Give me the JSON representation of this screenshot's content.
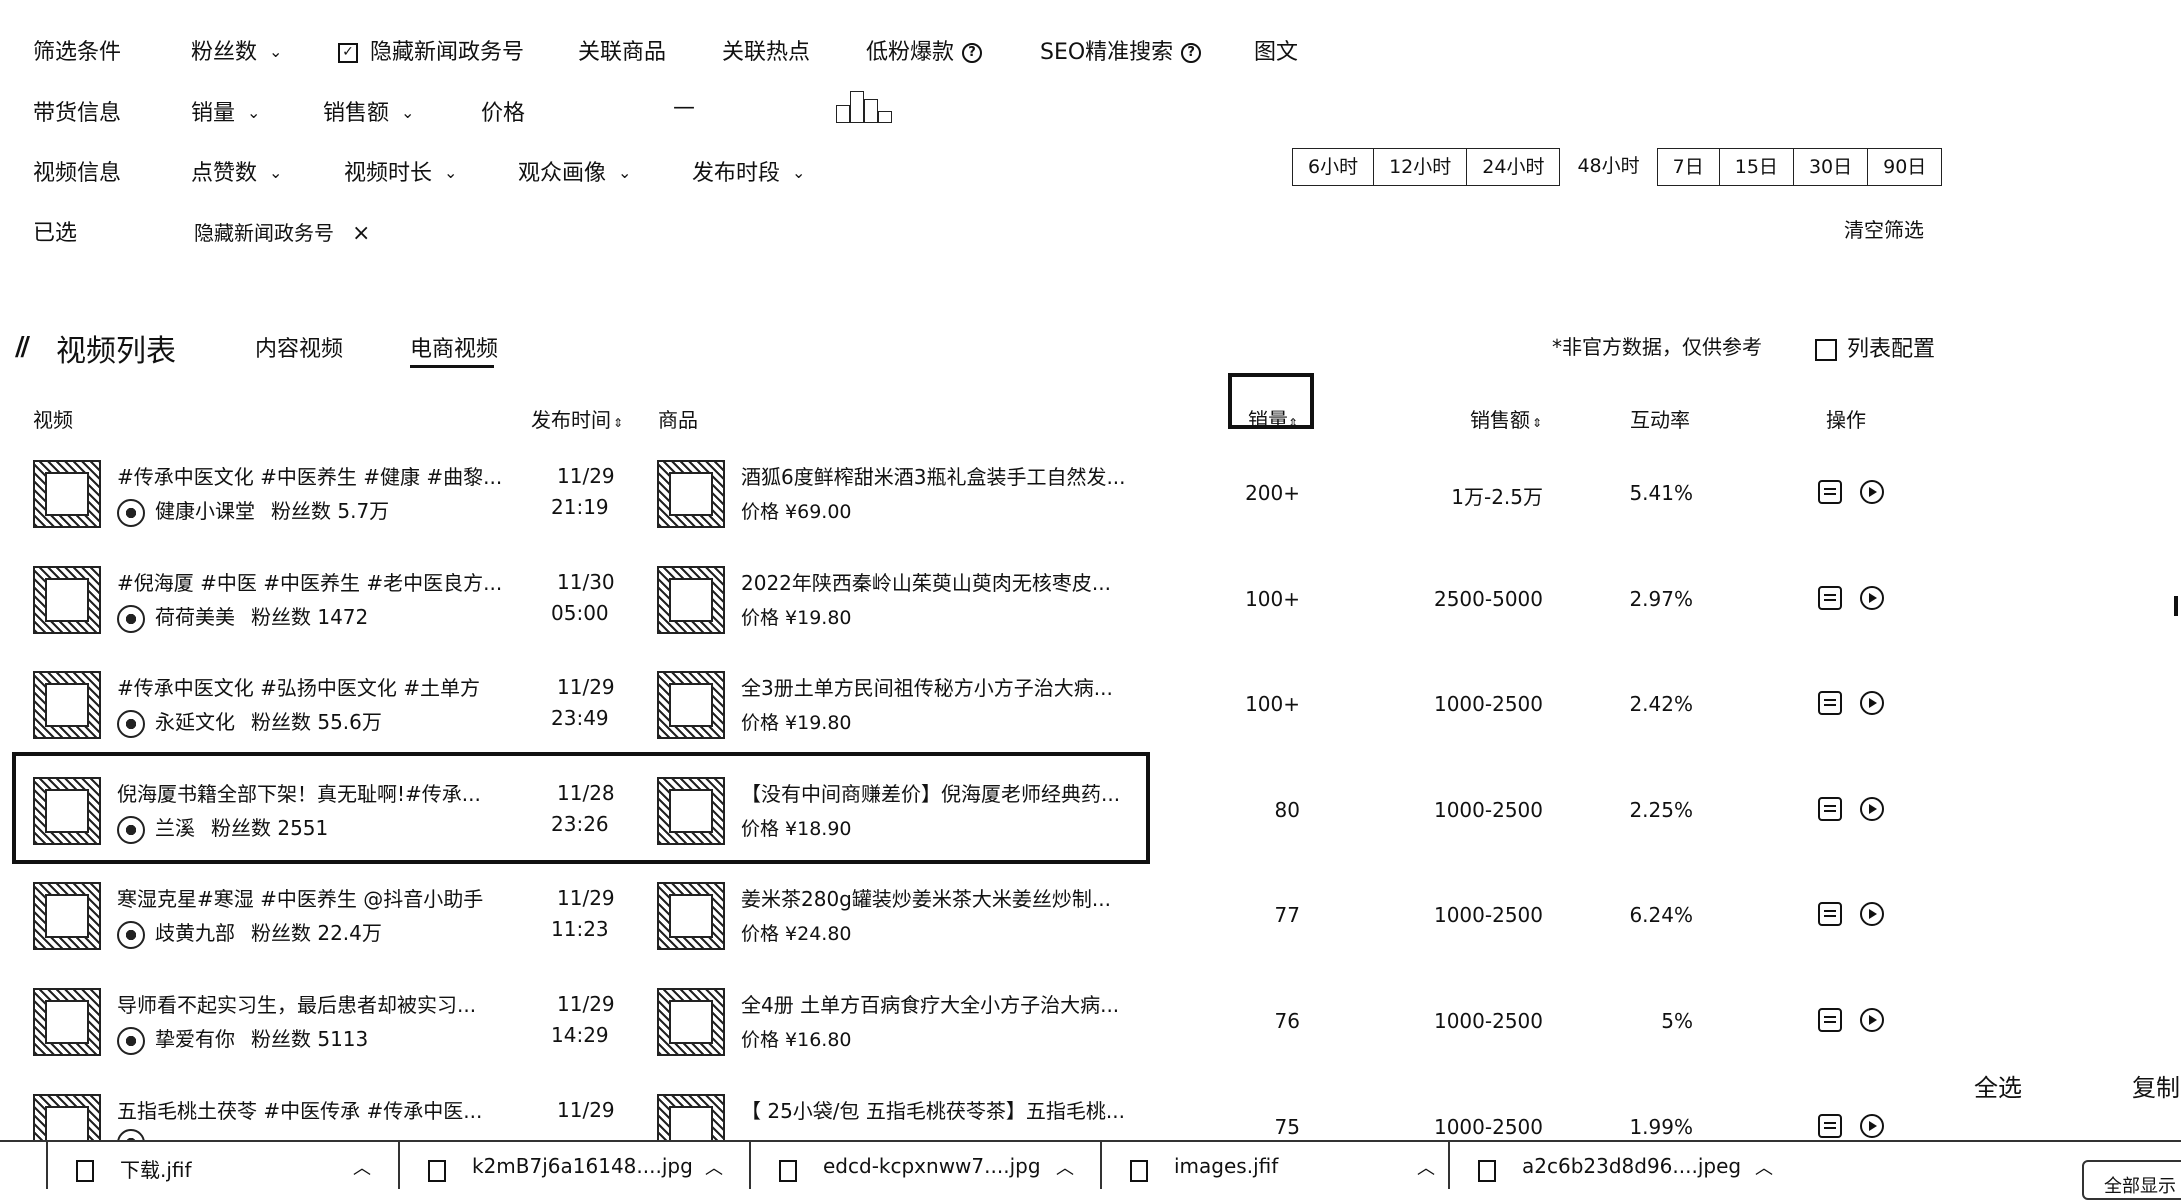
{
  "filters": {
    "row1": {
      "label": "筛选条件",
      "fans": "粉丝数",
      "hide_news": "隐藏新闻政务号",
      "related_goods": "关联商品",
      "related_hot": "关联热点",
      "low_fan_hit": "低粉爆款",
      "seo": "SEO精准搜索",
      "image_text": "图文"
    },
    "row2": {
      "label": "带货信息",
      "sales": "销量",
      "sales_amount": "销售额",
      "price": "价格",
      "dash": "—"
    },
    "row3": {
      "label": "视频信息",
      "likes": "点赞数",
      "duration": "视频时长",
      "audience": "观众画像",
      "publish_period": "发布时段",
      "time_ranges": [
        "6小时",
        "12小时",
        "24小时",
        "48小时",
        "7日",
        "15日",
        "30日",
        "90日"
      ],
      "selected_range": "48小时"
    },
    "row4": {
      "label": "已选",
      "tag": "隐藏新闻政务号",
      "remove": "×",
      "clear": "清空筛选"
    }
  },
  "list": {
    "title": "视频列表",
    "tabs": [
      "内容视频",
      "电商视频"
    ],
    "active_tab": "电商视频",
    "note": "*非官方数据，仅供参考",
    "config": "列表配置",
    "headers": {
      "video": "视频",
      "time": "发布时间",
      "goods": "商品",
      "sales": "销量",
      "amount": "销售额",
      "rate": "互动率",
      "ops": "操作"
    },
    "rows": [
      {
        "title": "#传承中医文化 #中医养生 #健康 #曲黎...",
        "author": "健康小课堂",
        "fans": "粉丝数 5.7万",
        "date": "11/29",
        "time": "21:19",
        "goods": "酒狐6度鲜榨甜米酒3瓶礼盒装手工自然发...",
        "price": "价格 ¥69.00",
        "sales": "200+",
        "amount": "1万-2.5万",
        "rate": "5.41%"
      },
      {
        "title": "#倪海厦 #中医 #中医养生 #老中医良方...",
        "author": "荷荷美美",
        "fans": "粉丝数 1472",
        "date": "11/30",
        "time": "05:00",
        "goods": "2022年陕西秦岭山茱萸山萸肉无核枣皮...",
        "price": "价格 ¥19.80",
        "sales": "100+",
        "amount": "2500-5000",
        "rate": "2.97%"
      },
      {
        "title": "#传承中医文化 #弘扬中医文化 #土单方",
        "author": "永延文化",
        "fans": "粉丝数 55.6万",
        "date": "11/29",
        "time": "23:49",
        "goods": "全3册土单方民间祖传秘方小方子治大病...",
        "price": "价格 ¥19.80",
        "sales": "100+",
        "amount": "1000-2500",
        "rate": "2.42%"
      },
      {
        "title": "倪海厦书籍全部下架！真无耻啊!#传承...",
        "author": "兰溪",
        "fans": "粉丝数 2551",
        "date": "11/28",
        "time": "23:26",
        "goods": "【没有中间商赚差价】倪海厦老师经典药...",
        "price": "价格 ¥18.90",
        "sales": "80",
        "amount": "1000-2500",
        "rate": "2.25%"
      },
      {
        "title": "寒湿克星#寒湿 #中医养生 @抖音小助手",
        "author": "歧黄九部",
        "fans": "粉丝数 22.4万",
        "date": "11/29",
        "time": "11:23",
        "goods": "姜米茶280g罐装炒姜米茶大米姜丝炒制...",
        "price": "价格 ¥24.80",
        "sales": "77",
        "amount": "1000-2500",
        "rate": "6.24%"
      },
      {
        "title": "导师看不起实习生，最后患者却被实习...",
        "author": "挚爱有你",
        "fans": "粉丝数 5113",
        "date": "11/29",
        "time": "14:29",
        "goods": "全4册 土单方百病食疗大全小方子治大病...",
        "price": "价格 ¥16.80",
        "sales": "76",
        "amount": "1000-2500",
        "rate": "5%"
      },
      {
        "title": "五指毛桃土茯苓 #中医传承 #传承中医...",
        "author": "",
        "fans": "",
        "date": "11/29",
        "time": "",
        "goods": "【 25小袋/包 五指毛桃茯苓茶】五指毛桃...",
        "price": "",
        "sales": "75",
        "amount": "1000-2500",
        "rate": "1.99%"
      }
    ]
  },
  "side": {
    "select_all": "全选",
    "copy": "复制"
  },
  "downloads": [
    {
      "name": "下载.jfif"
    },
    {
      "name": "k2mB7j6a16148....jpg"
    },
    {
      "name": "edcd-kcpxnww7....jpg"
    },
    {
      "name": "images.jfif"
    },
    {
      "name": "a2c6b23d8d96....jpeg"
    }
  ],
  "show_all": "全部显示"
}
